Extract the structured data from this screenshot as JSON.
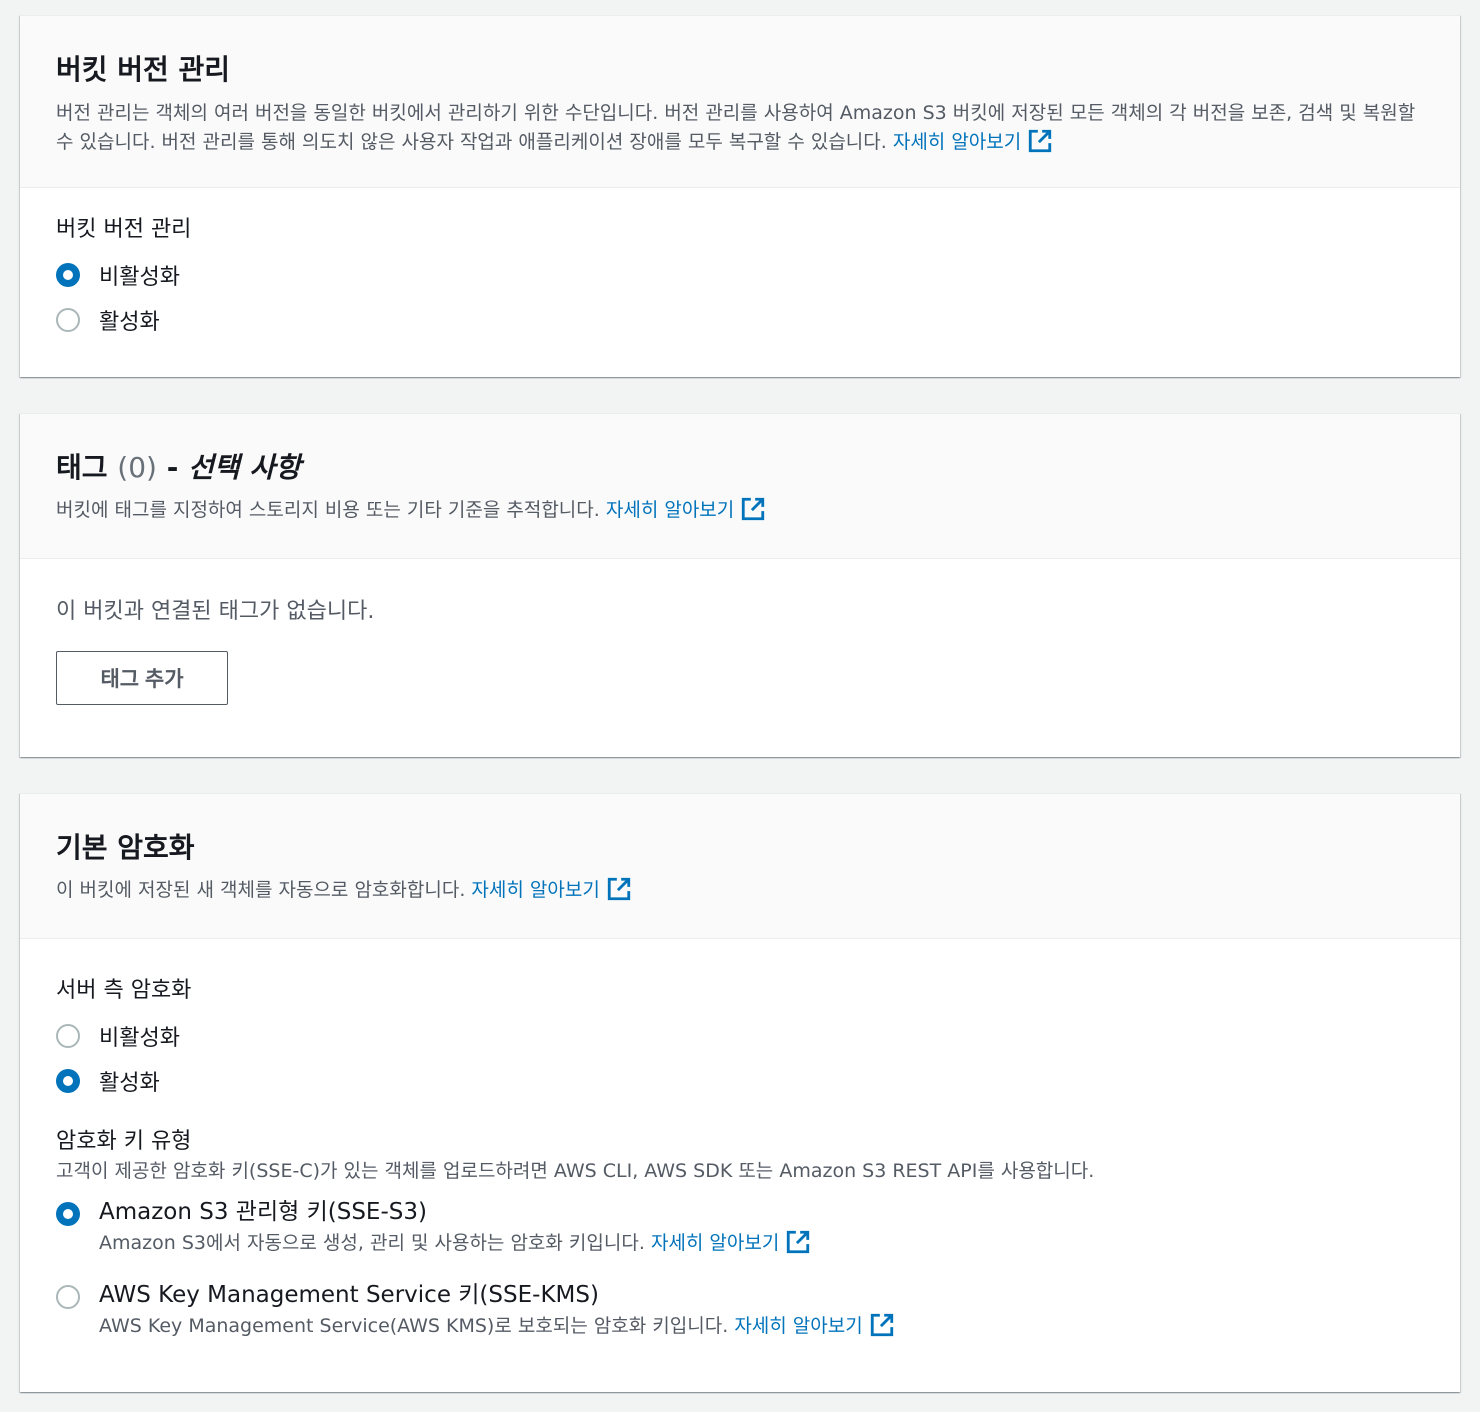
{
  "versioning": {
    "title": "버킷 버전 관리",
    "description": "버전 관리는 객체의 여러 버전을 동일한 버킷에서 관리하기 위한 수단입니다. 버전 관리를 사용하여 Amazon S3 버킷에 저장된 모든 객체의 각 버전을 보존, 검색 및 복원할 수 있습니다. 버전 관리를 통해 의도치 않은 사용자 작업과 애플리케이션 장애를 모두 복구할 수 있습니다.",
    "learn_more": "자세히 알아보기",
    "field_label": "버킷 버전 관리",
    "options": [
      {
        "label": "비활성화",
        "checked": true
      },
      {
        "label": "활성화",
        "checked": false
      }
    ]
  },
  "tags": {
    "title_main": "태그",
    "title_count": "(0)",
    "title_dash": "-",
    "title_optional": "선택 사항",
    "description": "버킷에 태그를 지정하여 스토리지 비용 또는 기타 기준을 추적합니다.",
    "learn_more": "자세히 알아보기",
    "empty_text": "이 버킷과 연결된 태그가 없습니다.",
    "add_button": "태그 추가"
  },
  "encryption": {
    "title": "기본 암호화",
    "description": "이 버킷에 저장된 새 객체를 자동으로 암호화합니다.",
    "learn_more": "자세히 알아보기",
    "server_side_label": "서버 측 암호화",
    "server_side_options": [
      {
        "label": "비활성화",
        "checked": false
      },
      {
        "label": "활성화",
        "checked": true
      }
    ],
    "key_type_label": "암호화 키 유형",
    "key_type_desc": "고객이 제공한 암호화 키(SSE-C)가 있는 객체를 업로드하려면 AWS CLI, AWS SDK 또는 Amazon S3 REST API를 사용합니다.",
    "key_options": [
      {
        "label": "Amazon S3 관리형 키(SSE-S3)",
        "desc": "Amazon S3에서 자동으로 생성, 관리 및 사용하는 암호화 키입니다.",
        "learn_more": "자세히 알아보기",
        "checked": true
      },
      {
        "label": "AWS Key Management Service 키(SSE-KMS)",
        "desc": "AWS Key Management Service(AWS KMS)로 보호되는 암호화 키입니다.",
        "learn_more": "자세히 알아보기",
        "checked": false
      }
    ]
  },
  "colors": {
    "link": "#0073bb",
    "radio_selected": "#0073bb",
    "page_bg": "#f2f3f3"
  },
  "icons": {
    "external_link": "external-link-icon"
  }
}
